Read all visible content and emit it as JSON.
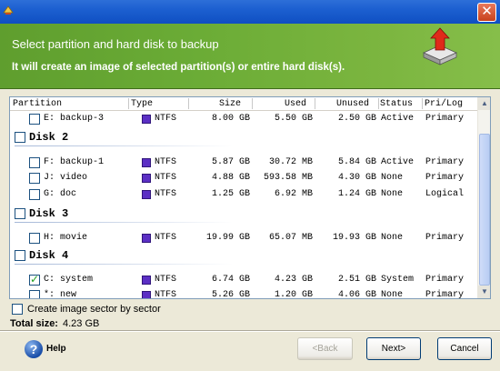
{
  "header": {
    "title": "Select partition and hard disk to backup",
    "subtitle": "It will create an image of selected partition(s) or entire hard disk(s)."
  },
  "columns": {
    "partition": "Partition",
    "type": "Type",
    "size": "Size",
    "used": "Used",
    "unused": "Unused",
    "status": "Status",
    "prilog": "Pri/Log"
  },
  "rows": [
    {
      "name": "E: backup-3",
      "type": "NTFS",
      "size": "8.00 GB",
      "used": "5.50 GB",
      "unused": "2.50 GB",
      "status": "Active",
      "prilog": "Primary",
      "checked": false
    },
    {
      "disk": "Disk 2"
    },
    {
      "name": "F: backup-1",
      "type": "NTFS",
      "size": "5.87 GB",
      "used": "30.72 MB",
      "unused": "5.84 GB",
      "status": "Active",
      "prilog": "Primary",
      "checked": false
    },
    {
      "name": "J: video",
      "type": "NTFS",
      "size": "4.88 GB",
      "used": "593.58 MB",
      "unused": "4.30 GB",
      "status": "None",
      "prilog": "Primary",
      "checked": false
    },
    {
      "name": "G: doc",
      "type": "NTFS",
      "size": "1.25 GB",
      "used": "6.92 MB",
      "unused": "1.24 GB",
      "status": "None",
      "prilog": "Logical",
      "checked": false
    },
    {
      "disk": "Disk 3"
    },
    {
      "name": "H: movie",
      "type": "NTFS",
      "size": "19.99 GB",
      "used": "65.07 MB",
      "unused": "19.93 GB",
      "status": "None",
      "prilog": "Primary",
      "checked": false
    },
    {
      "disk": "Disk 4"
    },
    {
      "name": "C: system",
      "type": "NTFS",
      "size": "6.74 GB",
      "used": "4.23 GB",
      "unused": "2.51 GB",
      "status": "System",
      "prilog": "Primary",
      "checked": true
    },
    {
      "name": "*: new",
      "type": "NTFS",
      "size": "5.26 GB",
      "used": "1.20 GB",
      "unused": "4.06 GB",
      "status": "None",
      "prilog": "Primary",
      "checked": false
    }
  ],
  "options": {
    "sector_label": "Create image sector by sector",
    "total_label": "Total size:",
    "total_value": "4.23 GB"
  },
  "buttons": {
    "help": "Help",
    "back": "<Back",
    "next": "Next>",
    "cancel": "Cancel"
  },
  "colors": {
    "header_green": "#6bac36",
    "ntfs_swatch": "#5b2fc4",
    "title_blue": "#1c5fd0"
  },
  "icons": {
    "app": "app-icon",
    "close": "close-icon",
    "header": "hard-disk-upload-icon",
    "help": "help-icon"
  }
}
